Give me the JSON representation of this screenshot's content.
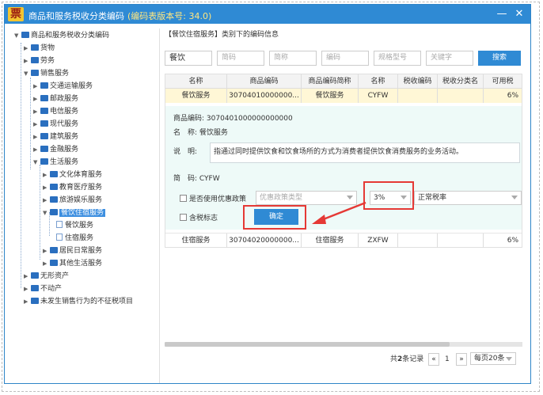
{
  "window": {
    "app_icon": "票",
    "title": "商品和服务税收分类编码",
    "subtitle": "(编码表版本号: 34.0)",
    "minimize": "—",
    "close": "✕"
  },
  "tree": {
    "root": "商品和服务税收分类编码",
    "items": [
      {
        "label": "货物"
      },
      {
        "label": "劳务"
      },
      {
        "label": "销售服务"
      },
      {
        "label": "交通运输服务"
      },
      {
        "label": "邮政服务"
      },
      {
        "label": "电信服务"
      },
      {
        "label": "现代服务"
      },
      {
        "label": "建筑服务"
      },
      {
        "label": "金融服务"
      },
      {
        "label": "生活服务"
      },
      {
        "label": "文化体育服务"
      },
      {
        "label": "教育医疗服务"
      },
      {
        "label": "旅游娱乐服务"
      },
      {
        "label": "餐饮住宿服务"
      },
      {
        "label": "餐饮服务"
      },
      {
        "label": "住宿服务"
      },
      {
        "label": "居民日常服务"
      },
      {
        "label": "其他生活服务"
      },
      {
        "label": "无形资产"
      },
      {
        "label": "不动产"
      },
      {
        "label": "未发生销售行为的不征税项目"
      }
    ]
  },
  "panel": {
    "title": "【餐饮住宿服务】类别下的编码信息"
  },
  "search": {
    "name_value": "餐饮",
    "fields": [
      "简码",
      "简称",
      "编码",
      "规格型号",
      "关键字"
    ],
    "button": "搜索"
  },
  "grid": {
    "columns": [
      "名称",
      "商品编码",
      "商品编码简称",
      "名称",
      "税收编码",
      "税收分类名",
      "可用税"
    ],
    "rows": [
      [
        "餐饮服务",
        "30704010000000...",
        "餐饮服务",
        "CYFW",
        "",
        "",
        "6%"
      ],
      [
        "住宿服务",
        "30704020000000...",
        "住宿服务",
        "ZXFW",
        "",
        "",
        "6%"
      ]
    ]
  },
  "detail": {
    "code_label": "商品编码:",
    "code_value": "3070401000000000000",
    "name_label": "名　称:",
    "name_value": "餐饮服务",
    "desc_label": "说　明:",
    "desc_value": "指通过同时提供饮食和饮食场所的方式为消费者提供饮食消费服务的业务活动。",
    "short_label": "简　码:",
    "short_value": "CYFW",
    "preferential_label": "是否使用优惠政策",
    "preferential_placeholder": "优惠政策类型",
    "rate_value": "3%",
    "rate_type": "正常税率",
    "tax_included_label": "含税标志",
    "confirm_button": "确定"
  },
  "pager": {
    "summary_prefix": "共",
    "summary_count": "2",
    "summary_suffix": "条记录",
    "prev": "«",
    "page": "1",
    "next": "»",
    "per_page": "每页20条"
  },
  "colors": {
    "title_bar": "#2f8ad4",
    "selected_row": "#fff7d6",
    "detail_bg": "#eefaf8",
    "highlight_red": "#e53935"
  }
}
